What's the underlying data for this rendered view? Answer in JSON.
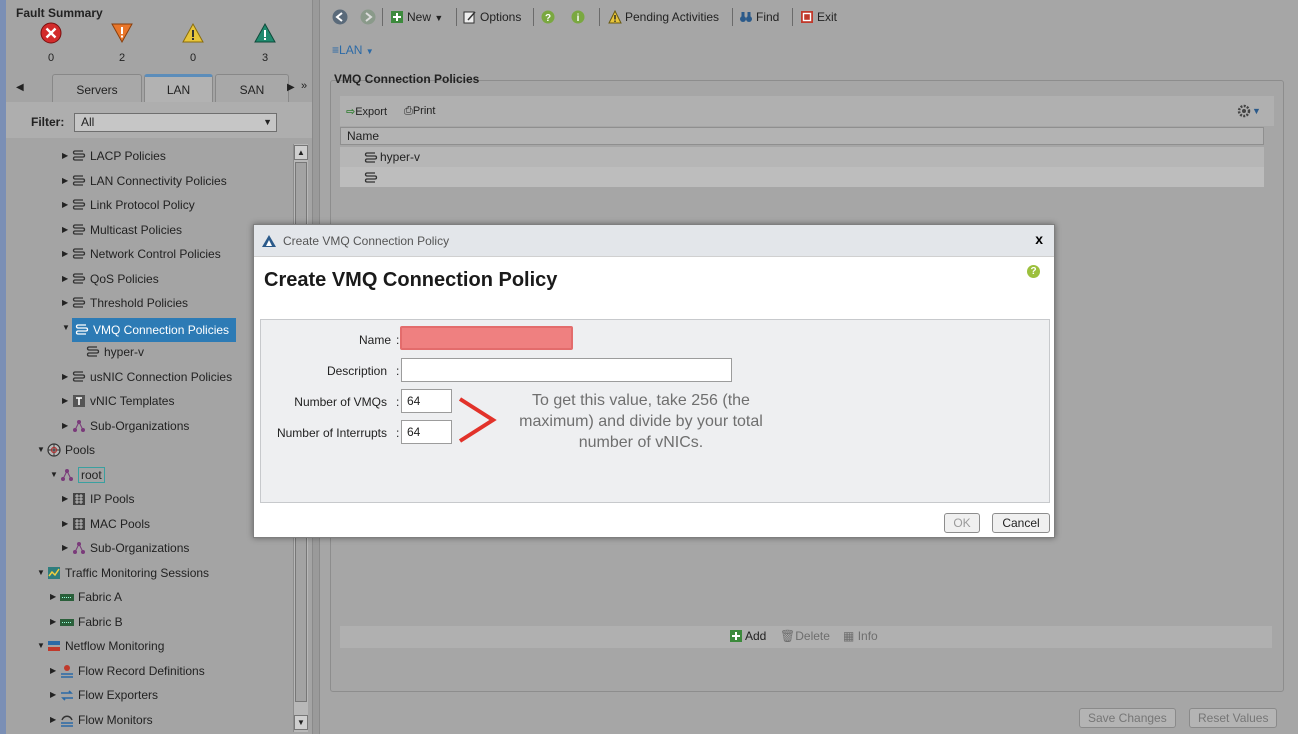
{
  "fault_summary": {
    "title": "Fault Summary",
    "counts": [
      {
        "type": "critical",
        "icon": "critical-x-icon",
        "count": "0",
        "color": "#d22b2b"
      },
      {
        "type": "major",
        "icon": "major-down-triangle-icon",
        "count": "2",
        "color": "#e8762b"
      },
      {
        "type": "minor",
        "icon": "minor-warning-triangle-icon",
        "count": "0",
        "color": "#e8c53a"
      },
      {
        "type": "warning",
        "icon": "warning-triangle-icon",
        "count": "3",
        "color": "#1f8a6e"
      }
    ]
  },
  "nav_tabs": [
    {
      "label": "Servers",
      "active": false
    },
    {
      "label": "LAN",
      "active": true
    },
    {
      "label": "SAN",
      "active": false
    }
  ],
  "filter": {
    "label": "Filter:",
    "value": "All"
  },
  "tree": [
    {
      "label": "LACP Policies",
      "icon": "policy-icon"
    },
    {
      "label": "LAN Connectivity Policies",
      "icon": "policy-icon"
    },
    {
      "label": "Link Protocol Policy",
      "icon": "policy-icon"
    },
    {
      "label": "Multicast Policies",
      "icon": "policy-icon"
    },
    {
      "label": "Network Control Policies",
      "icon": "policy-icon"
    },
    {
      "label": "QoS Policies",
      "icon": "policy-icon"
    },
    {
      "label": "Threshold Policies",
      "icon": "policy-icon"
    },
    {
      "label": "VMQ Connection Policies",
      "icon": "policy-icon",
      "selected": true
    },
    {
      "label": "hyper-v",
      "icon": "policy-icon"
    },
    {
      "label": "usNIC Connection Policies",
      "icon": "policy-icon"
    },
    {
      "label": "vNIC Templates",
      "icon": "template-icon"
    },
    {
      "label": "Sub-Organizations",
      "icon": "org-icon"
    },
    {
      "label": "Pools",
      "icon": "pools-globe-icon"
    },
    {
      "label": "root",
      "icon": "org-icon"
    },
    {
      "label": "IP Pools",
      "icon": "pool-icon"
    },
    {
      "label": "MAC Pools",
      "icon": "pool-icon"
    },
    {
      "label": "Sub-Organizations",
      "icon": "org-icon"
    },
    {
      "label": "Traffic Monitoring Sessions",
      "icon": "monitoring-icon"
    },
    {
      "label": "Fabric A",
      "icon": "fabric-icon"
    },
    {
      "label": "Fabric B",
      "icon": "fabric-icon"
    },
    {
      "label": "Netflow Monitoring",
      "icon": "netflow-icon"
    },
    {
      "label": "Flow Record Definitions",
      "icon": "flow-record-icon"
    },
    {
      "label": "Flow Exporters",
      "icon": "flow-exporter-icon"
    },
    {
      "label": "Flow Monitors",
      "icon": "flow-monitor-icon"
    }
  ],
  "toolbar": {
    "new_label": "New",
    "options_label": "Options",
    "pending_label": "Pending Activities",
    "find_label": "Find",
    "exit_label": "Exit"
  },
  "breadcrumb": {
    "label": "LAN"
  },
  "panel": {
    "title": "VMQ Connection Policies",
    "export_label": "Export",
    "print_label": "Print",
    "column_name": "Name",
    "rows": [
      "hyper-v",
      ""
    ],
    "add_label": "Add",
    "delete_label": "Delete",
    "info_label": "Info"
  },
  "footer": {
    "save_label": "Save Changes",
    "reset_label": "Reset Values"
  },
  "dialog": {
    "window_title": "Create VMQ Connection Policy",
    "close_label": "x",
    "heading": "Create VMQ Connection Policy",
    "help_label": "?",
    "fields": {
      "name_label": "Name",
      "name_value": "",
      "description_label": "Description",
      "description_value": "",
      "vmqs_label": "Number of VMQs",
      "vmqs_value": "64",
      "interrupts_label": "Number of Interrupts",
      "interrupts_value": "64"
    },
    "annotation": "To get this value, take 256 (the maximum) and divide by your total number of vNICs.",
    "ok_label": "OK",
    "cancel_label": "Cancel"
  }
}
